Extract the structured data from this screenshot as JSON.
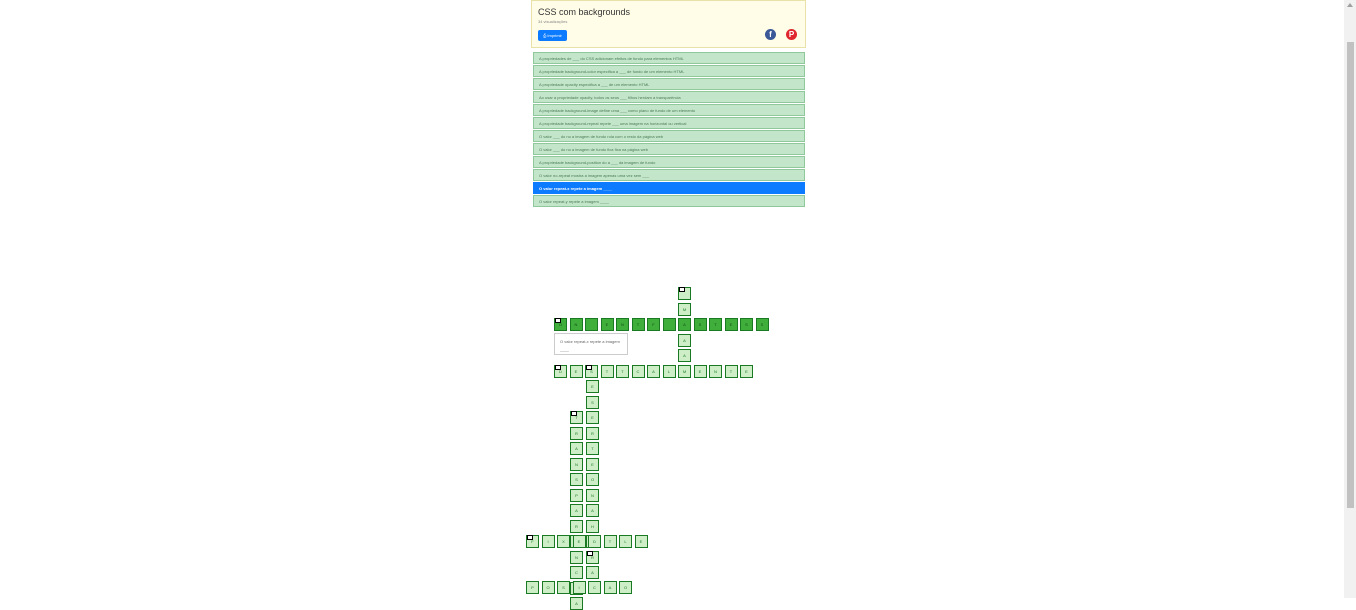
{
  "header": {
    "title": "CSS com backgrounds",
    "views": "34 visualizações",
    "print_label": "Imprimir",
    "facebook_glyph": "f",
    "pinterest_glyph": "P"
  },
  "clues": [
    "A propriedades de ___ do CSS adicionam efeitos de fundo para elementos HTML",
    "A propriedade background-color especifica a ___ de fundo de um elemento HTML",
    "A propriedade opacity especifica a ___ de um elemento HTML",
    "Ao usar a propriedade opacity, todos os seus ___ filhos herdam a transparência",
    "A propriedade background-image define uma ___ como plano de fundo de um elemento",
    "A propriedade background-repeat repete ___ uma imagem na horizontal ou vertical",
    "O valor ___ do no a imagem de fundo rola com o resto da página web",
    "O valor ___ do no a imagem de fundo fica fixa na página web",
    "A propriedade background-position do a ___ da imagem de fundo",
    "O valor no-repeat mostra a imagem apenas uma vez sem ___",
    "O valor repeat-x repete a imagem ____",
    "O valor repeat-y repete a imagem ____"
  ],
  "active_clue_index": 10,
  "tooltip_text": "O valor repeat-x repete a imagem ____",
  "grid": {
    "row1": [
      "O",
      "N",
      "",
      "E",
      "N",
      "T",
      "F",
      "",
      "A",
      "S",
      "T",
      "E",
      "S",
      "S"
    ],
    "col_vertical_top": [
      "",
      "M",
      "",
      "A",
      "A"
    ],
    "row2": [
      "D",
      "E",
      "S",
      "T",
      "T",
      "C",
      "A",
      "L",
      "M",
      "E",
      "N",
      "T",
      "E"
    ],
    "col_a": [
      "T",
      "R",
      "A",
      "N",
      "S",
      "P",
      "A",
      "R",
      "E",
      "N",
      "C",
      "I",
      "A"
    ],
    "col_b": [
      "E",
      "S",
      "E",
      "R",
      "T",
      "E",
      "O",
      "N",
      "A",
      "H",
      "O",
      "R",
      "A"
    ],
    "row3": [
      "F",
      "I",
      "X",
      "E",
      "D",
      "T",
      "L",
      "E"
    ],
    "row4": [
      "P",
      "O",
      "S",
      "I",
      "C",
      "A",
      "O"
    ]
  },
  "colors": {
    "cell_border": "#1a7a24",
    "cell_empty": "#cdeec7",
    "cell_filled": "#3fae3a",
    "active": "#0d7bff",
    "clue_bg": "#c3e6cb"
  }
}
